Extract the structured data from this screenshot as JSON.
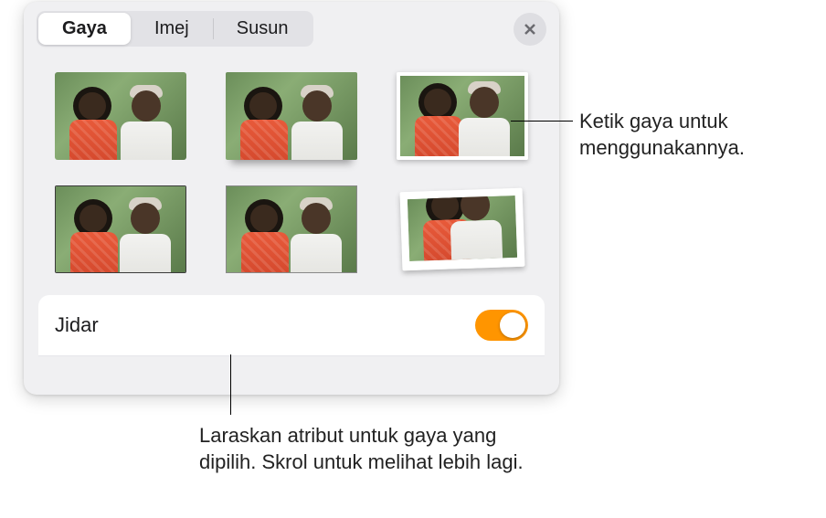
{
  "tabs": [
    {
      "label": "Gaya",
      "active": true
    },
    {
      "label": "Imej",
      "active": false
    },
    {
      "label": "Susun",
      "active": false
    }
  ],
  "styles_grid": {
    "items": [
      {
        "name": "style-plain"
      },
      {
        "name": "style-reflection"
      },
      {
        "name": "style-white-frame"
      },
      {
        "name": "style-thin-dark-border"
      },
      {
        "name": "style-thin-light-border"
      },
      {
        "name": "style-polaroid-tilt"
      }
    ]
  },
  "jidar": {
    "label": "Jidar",
    "enabled": true
  },
  "callouts": {
    "use_style": "Ketik gaya untuk menggunakannya.",
    "adjust_attr": "Laraskan atribut untuk gaya yang dipilih. Skrol untuk melihat lebih lagi."
  },
  "icons": {
    "close": "close-icon"
  },
  "colors": {
    "accent": "#ff9500"
  }
}
